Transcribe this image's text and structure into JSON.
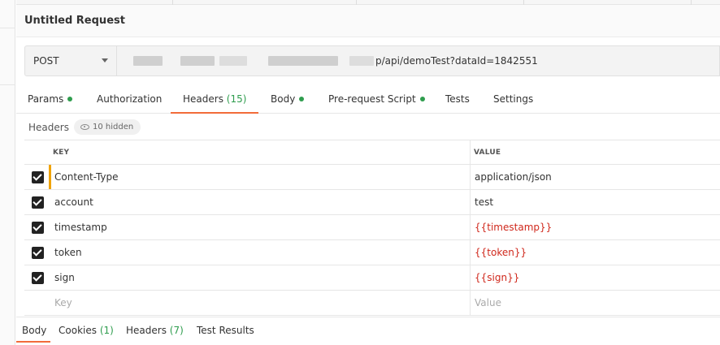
{
  "request": {
    "title": "Untitled Request",
    "method": "POST",
    "url_visible_part": "p/api/demoTest?dataId=1842551"
  },
  "request_tabs": [
    {
      "label": "Params",
      "count": "",
      "dot": true
    },
    {
      "label": "Authorization",
      "count": "",
      "dot": false
    },
    {
      "label": "Headers",
      "count": "(15)",
      "dot": false,
      "active": true
    },
    {
      "label": "Body",
      "count": "",
      "dot": true
    },
    {
      "label": "Pre-request Script",
      "count": "",
      "dot": true
    },
    {
      "label": "Tests",
      "count": "",
      "dot": false
    },
    {
      "label": "Settings",
      "count": "",
      "dot": false
    }
  ],
  "headers_section": {
    "label": "Headers",
    "hidden_badge": "10 hidden",
    "col_key": "KEY",
    "col_value": "VALUE",
    "rows": [
      {
        "checked": true,
        "key": "Content-Type",
        "value": "application/json",
        "is_variable": false
      },
      {
        "checked": true,
        "key": "account",
        "value": "test",
        "is_variable": false
      },
      {
        "checked": true,
        "key": "timestamp",
        "value": "{{timestamp}}",
        "is_variable": true
      },
      {
        "checked": true,
        "key": "token",
        "value": "{{token}}",
        "is_variable": true
      },
      {
        "checked": true,
        "key": "sign",
        "value": "{{sign}}",
        "is_variable": true
      }
    ],
    "placeholder_key": "Key",
    "placeholder_value": "Value"
  },
  "response_tabs": [
    {
      "label": "Body",
      "count": "",
      "active": true
    },
    {
      "label": "Cookies",
      "count": "(1)"
    },
    {
      "label": "Headers",
      "count": "(7)"
    },
    {
      "label": "Test Results",
      "count": ""
    }
  ],
  "colors": {
    "accent": "#f26b3a",
    "status_green": "#2f9d4e",
    "variable_red": "#d0281c",
    "row_marker": "#f0a30a"
  }
}
